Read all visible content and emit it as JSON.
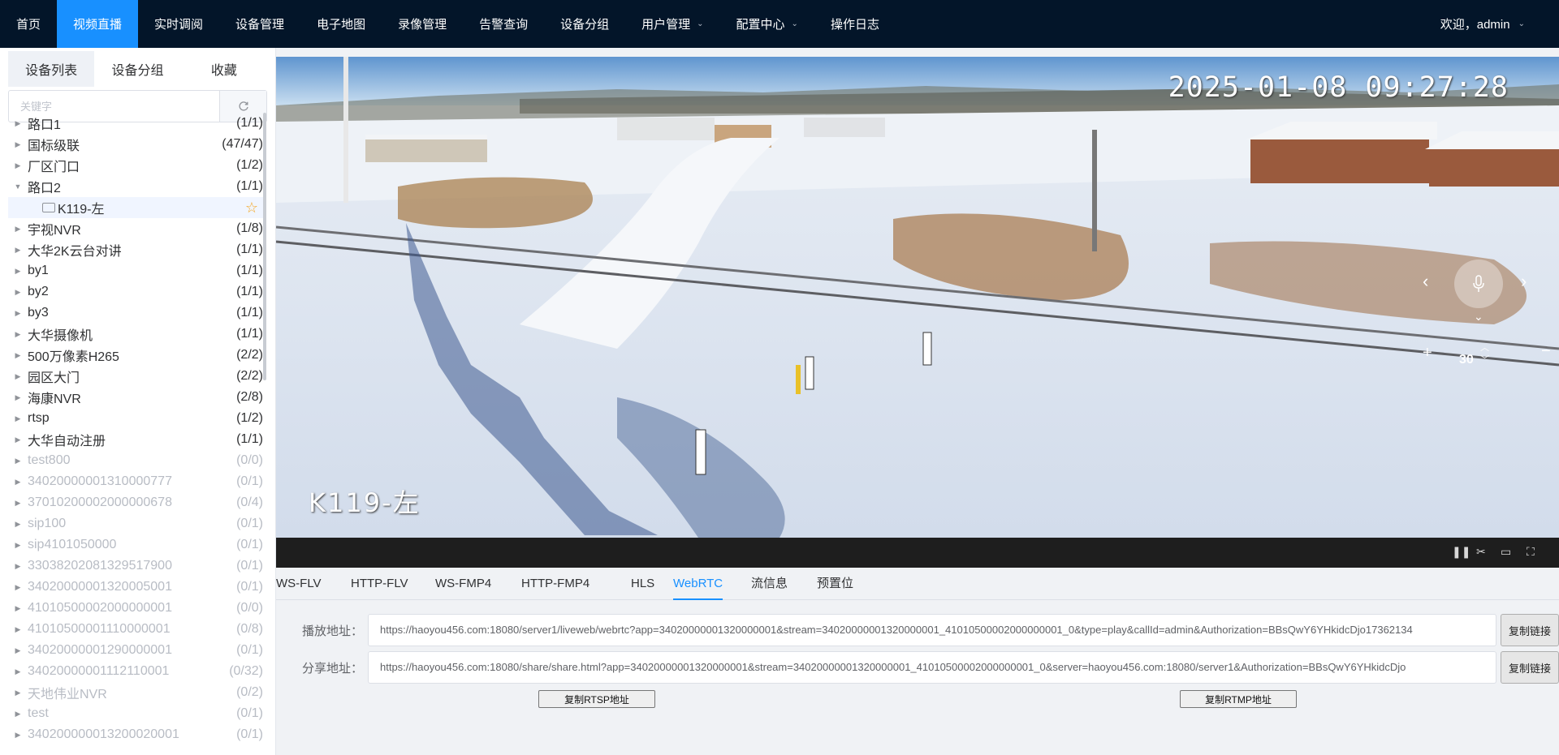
{
  "nav": {
    "items": [
      {
        "label": "首页",
        "active": false,
        "dropdown": false
      },
      {
        "label": "视频直播",
        "active": true,
        "dropdown": false
      },
      {
        "label": "实时调阅",
        "active": false,
        "dropdown": false
      },
      {
        "label": "设备管理",
        "active": false,
        "dropdown": false
      },
      {
        "label": "电子地图",
        "active": false,
        "dropdown": false
      },
      {
        "label": "录像管理",
        "active": false,
        "dropdown": false
      },
      {
        "label": "告警查询",
        "active": false,
        "dropdown": false
      },
      {
        "label": "设备分组",
        "active": false,
        "dropdown": false
      },
      {
        "label": "用户管理",
        "active": false,
        "dropdown": true
      },
      {
        "label": "配置中心",
        "active": false,
        "dropdown": true
      },
      {
        "label": "操作日志",
        "active": false,
        "dropdown": false
      }
    ],
    "welcome": "欢迎，admin"
  },
  "left_panel": {
    "tabs": [
      "设备列表",
      "设备分组",
      "收藏"
    ],
    "active_tab": 0,
    "search_placeholder": "关键字",
    "tree": [
      {
        "label": "路口1",
        "count": "(1/1)",
        "online": true
      },
      {
        "label": "国标级联",
        "count": "(47/47)",
        "online": true
      },
      {
        "label": "厂区门口",
        "count": "(1/2)",
        "online": true
      },
      {
        "label": "路口2",
        "count": "(1/1)",
        "online": true,
        "expanded": true
      },
      {
        "label": "K119-左",
        "count": "",
        "online": true,
        "child": true,
        "favorite": true
      },
      {
        "label": "宇视NVR",
        "count": "(1/8)",
        "online": true
      },
      {
        "label": "大华2K云台对讲",
        "count": "(1/1)",
        "online": true
      },
      {
        "label": "by1",
        "count": "(1/1)",
        "online": true
      },
      {
        "label": "by2",
        "count": "(1/1)",
        "online": true
      },
      {
        "label": "by3",
        "count": "(1/1)",
        "online": true
      },
      {
        "label": "大华摄像机",
        "count": "(1/1)",
        "online": true
      },
      {
        "label": "500万像素H265",
        "count": "(2/2)",
        "online": true
      },
      {
        "label": "园区大门",
        "count": "(2/2)",
        "online": true
      },
      {
        "label": "海康NVR",
        "count": "(2/8)",
        "online": true
      },
      {
        "label": "rtsp",
        "count": "(1/2)",
        "online": true
      },
      {
        "label": "大华自动注册",
        "count": "(1/1)",
        "online": true
      },
      {
        "label": "test800",
        "count": "(0/0)",
        "online": false
      },
      {
        "label": "34020000001310000777",
        "count": "(0/1)",
        "online": false
      },
      {
        "label": "37010200002000000678",
        "count": "(0/4)",
        "online": false
      },
      {
        "label": "sip100",
        "count": "(0/1)",
        "online": false
      },
      {
        "label": "sip4101050000",
        "count": "(0/1)",
        "online": false
      },
      {
        "label": "33038202081329517900",
        "count": "(0/1)",
        "online": false
      },
      {
        "label": "34020000001320005001",
        "count": "(0/1)",
        "online": false
      },
      {
        "label": "41010500002000000001",
        "count": "(0/0)",
        "online": false
      },
      {
        "label": "41010500001110000001",
        "count": "(0/8)",
        "online": false
      },
      {
        "label": "34020000001290000001",
        "count": "(0/1)",
        "online": false
      },
      {
        "label": "34020000001112110001",
        "count": "(0/32)",
        "online": false
      },
      {
        "label": "天地伟业NVR",
        "count": "(0/2)",
        "online": false
      },
      {
        "label": "test",
        "count": "(0/1)",
        "online": false
      },
      {
        "label": "340200000013200020001",
        "count": "(0/1)",
        "online": false
      }
    ]
  },
  "video": {
    "osd_timestamp": "2025-01-08 09:27:28",
    "osd_channel": "K119-左",
    "ptz_zoom": "30"
  },
  "player_tabs": {
    "items": [
      "WS-FLV",
      "HTTP-FLV",
      "WS-FMP4",
      "HTTP-FMP4",
      "HLS",
      "WebRTC",
      "流信息",
      "预置位"
    ],
    "active": 5
  },
  "address": {
    "play_label": "播放地址：",
    "play_url": "https://haoyou456.com:18080/server1/liveweb/webrtc?app=34020000001320000001&stream=34020000001320000001_41010500002000000001_0&type=play&callId=admin&Authorization=BBsQwY6YHkidcDjo17362134",
    "share_label": "分享地址：",
    "share_url": "https://haoyou456.com:18080/share/share.html?app=34020000001320000001&stream=34020000001320000001_41010500002000000001_0&server=haoyou456.com:18080/server1&Authorization=BBsQwY6YHkidcDjo",
    "copy_link_label": "复制链接",
    "copy_rtsp_label": "复制RTSP地址",
    "copy_rtmp_label": "复制RTMP地址"
  }
}
